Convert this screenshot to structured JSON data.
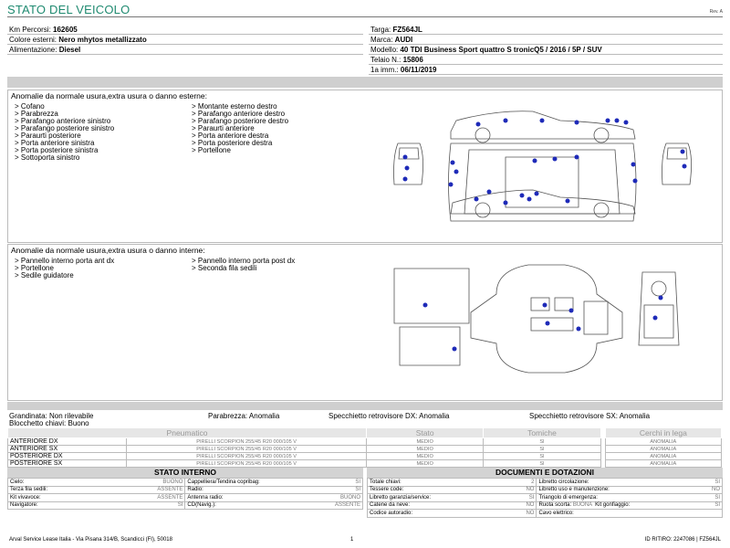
{
  "header": {
    "title": "STATO DEL VEICOLO",
    "rev": "Rev. A"
  },
  "vehicle": {
    "left": [
      {
        "label": "Km Percorsi: ",
        "value": "162605"
      },
      {
        "label": "Colore esterni: ",
        "value": "Nero mhytos metallizzato"
      },
      {
        "label": "Alimentazione: ",
        "value": "Diesel"
      }
    ],
    "right": [
      {
        "label": "Targa: ",
        "value": "FZ564JL"
      },
      {
        "label": "Marca: ",
        "value": "AUDI"
      },
      {
        "label": "Modello: ",
        "value": "40 TDI Business Sport quattro S tronicQ5 / 2016 / 5P / SUV"
      },
      {
        "label": "Telaio N.: ",
        "value": "15806"
      },
      {
        "label": "1a imm.: ",
        "value": "06/11/2019"
      }
    ]
  },
  "external": {
    "title": "Anomalie da normale usura,extra usura o danno esterne:",
    "col1": [
      "Cofano",
      "Parabrezza",
      "Parafango anteriore sinistro",
      "Parafango posteriore sinistro",
      "Paraurti posteriore",
      "Porta anteriore sinistra",
      "Porta posteriore sinistra",
      "Sottoporta sinistro"
    ],
    "col2": [
      "Montante esterno destro",
      "Parafango anteriore destro",
      "Parafango posteriore destro",
      "Paraurti anteriore",
      "Porta anteriore destra",
      "Porta posteriore destra",
      "Portellone"
    ]
  },
  "internal": {
    "title": "Anomalie da normale usura,extra usura o danno interne:",
    "col1": [
      "Pannello interno porta ant dx",
      "Portellone",
      "Sedile guidatore"
    ],
    "col2": [
      "Pannello interno porta post dx",
      "Seconda fila sedili"
    ]
  },
  "status": {
    "grandinata": "Grandinata: Non rilevabile",
    "parabrezza": "Parabrezza: Anomalia",
    "specchietto_dx": "Specchietto retrovisore DX: Anomalia",
    "specchietto_sx": "Specchietto retrovisore SX: Anomalia",
    "blocchetto": "Blocchetto chiavi: Buono"
  },
  "tyres": {
    "headers": [
      "Pneumatico",
      "Stato",
      "Tomiche",
      "Cerchi in lega"
    ],
    "rows": [
      {
        "pos": "ANTERIORE DX",
        "model": "PIRELLI SCORPION 255/45 R20 000/105 V",
        "stato": "MEDIO",
        "tomiche": "SI",
        "cerchi": "ANOMALIA"
      },
      {
        "pos": "ANTERIORE SX",
        "model": "PIRELLI SCORPION 255/45 R20 000/105 V",
        "stato": "MEDIO",
        "tomiche": "SI",
        "cerchi": "ANOMALIA"
      },
      {
        "pos": "POSTERIORE DX",
        "model": "PIRELLI SCORPION 255/45 R20 000/105 V",
        "stato": "MEDIO",
        "tomiche": "SI",
        "cerchi": "ANOMALIA"
      },
      {
        "pos": "POSTERIORE SX",
        "model": "PIRELLI SCORPION 255/45 R20 000/105 V",
        "stato": "MEDIO",
        "tomiche": "SI",
        "cerchi": "ANOMALIA"
      }
    ]
  },
  "interior": {
    "title": "STATO INTERNO",
    "rows": [
      [
        {
          "l": "Cielo:",
          "v": "BUONO"
        },
        {
          "l": "Cappelliera/Tendina copribag:",
          "v": "SI"
        }
      ],
      [
        {
          "l": "Terza fila sedili:",
          "v": "ASSENTE"
        },
        {
          "l": "Radio:",
          "v": "SI"
        }
      ],
      [
        {
          "l": "Kit vivavoce:",
          "v": "ASSENTE"
        },
        {
          "l": "Antenna radio:",
          "v": "BUONO"
        }
      ],
      [
        {
          "l": "Navigatore:",
          "v": "SI"
        },
        {
          "l": "CD(Navig.):",
          "v": "ASSENTE"
        }
      ]
    ]
  },
  "docs": {
    "title": "DOCUMENTI E DOTAZIONI",
    "rows": [
      [
        {
          "l": "Totale chiavi:",
          "v": "2"
        },
        {
          "l": "Libretto circolazione:",
          "v": "SI"
        }
      ],
      [
        {
          "l": "Tessere code:",
          "v": "NO"
        },
        {
          "l": "Libretto uso e manutenzione:",
          "v": "NO"
        }
      ],
      [
        {
          "l": "Libretto garanzia/service:",
          "v": "SI"
        },
        {
          "l": "Triangolo di emergenza:",
          "v": "SI"
        }
      ],
      [
        {
          "l": "Catene da neve:",
          "v": "NO"
        },
        {
          "l": "Ruota scorta:",
          "v": "BUONA",
          "l2": "Kit gonfiaggio:",
          "v2": "SI"
        }
      ],
      [
        {
          "l": "Codice autoradio:",
          "v": "NO"
        },
        {
          "l": "Cavo elettrico:",
          "v": ""
        }
      ]
    ]
  },
  "footer": {
    "left": "Arval Service Lease Italia - Via Pisana 314/B, Scandicci (FI), 50018",
    "page": "1",
    "right": "ID RITIRO: 2247086 | FZ564JL"
  }
}
